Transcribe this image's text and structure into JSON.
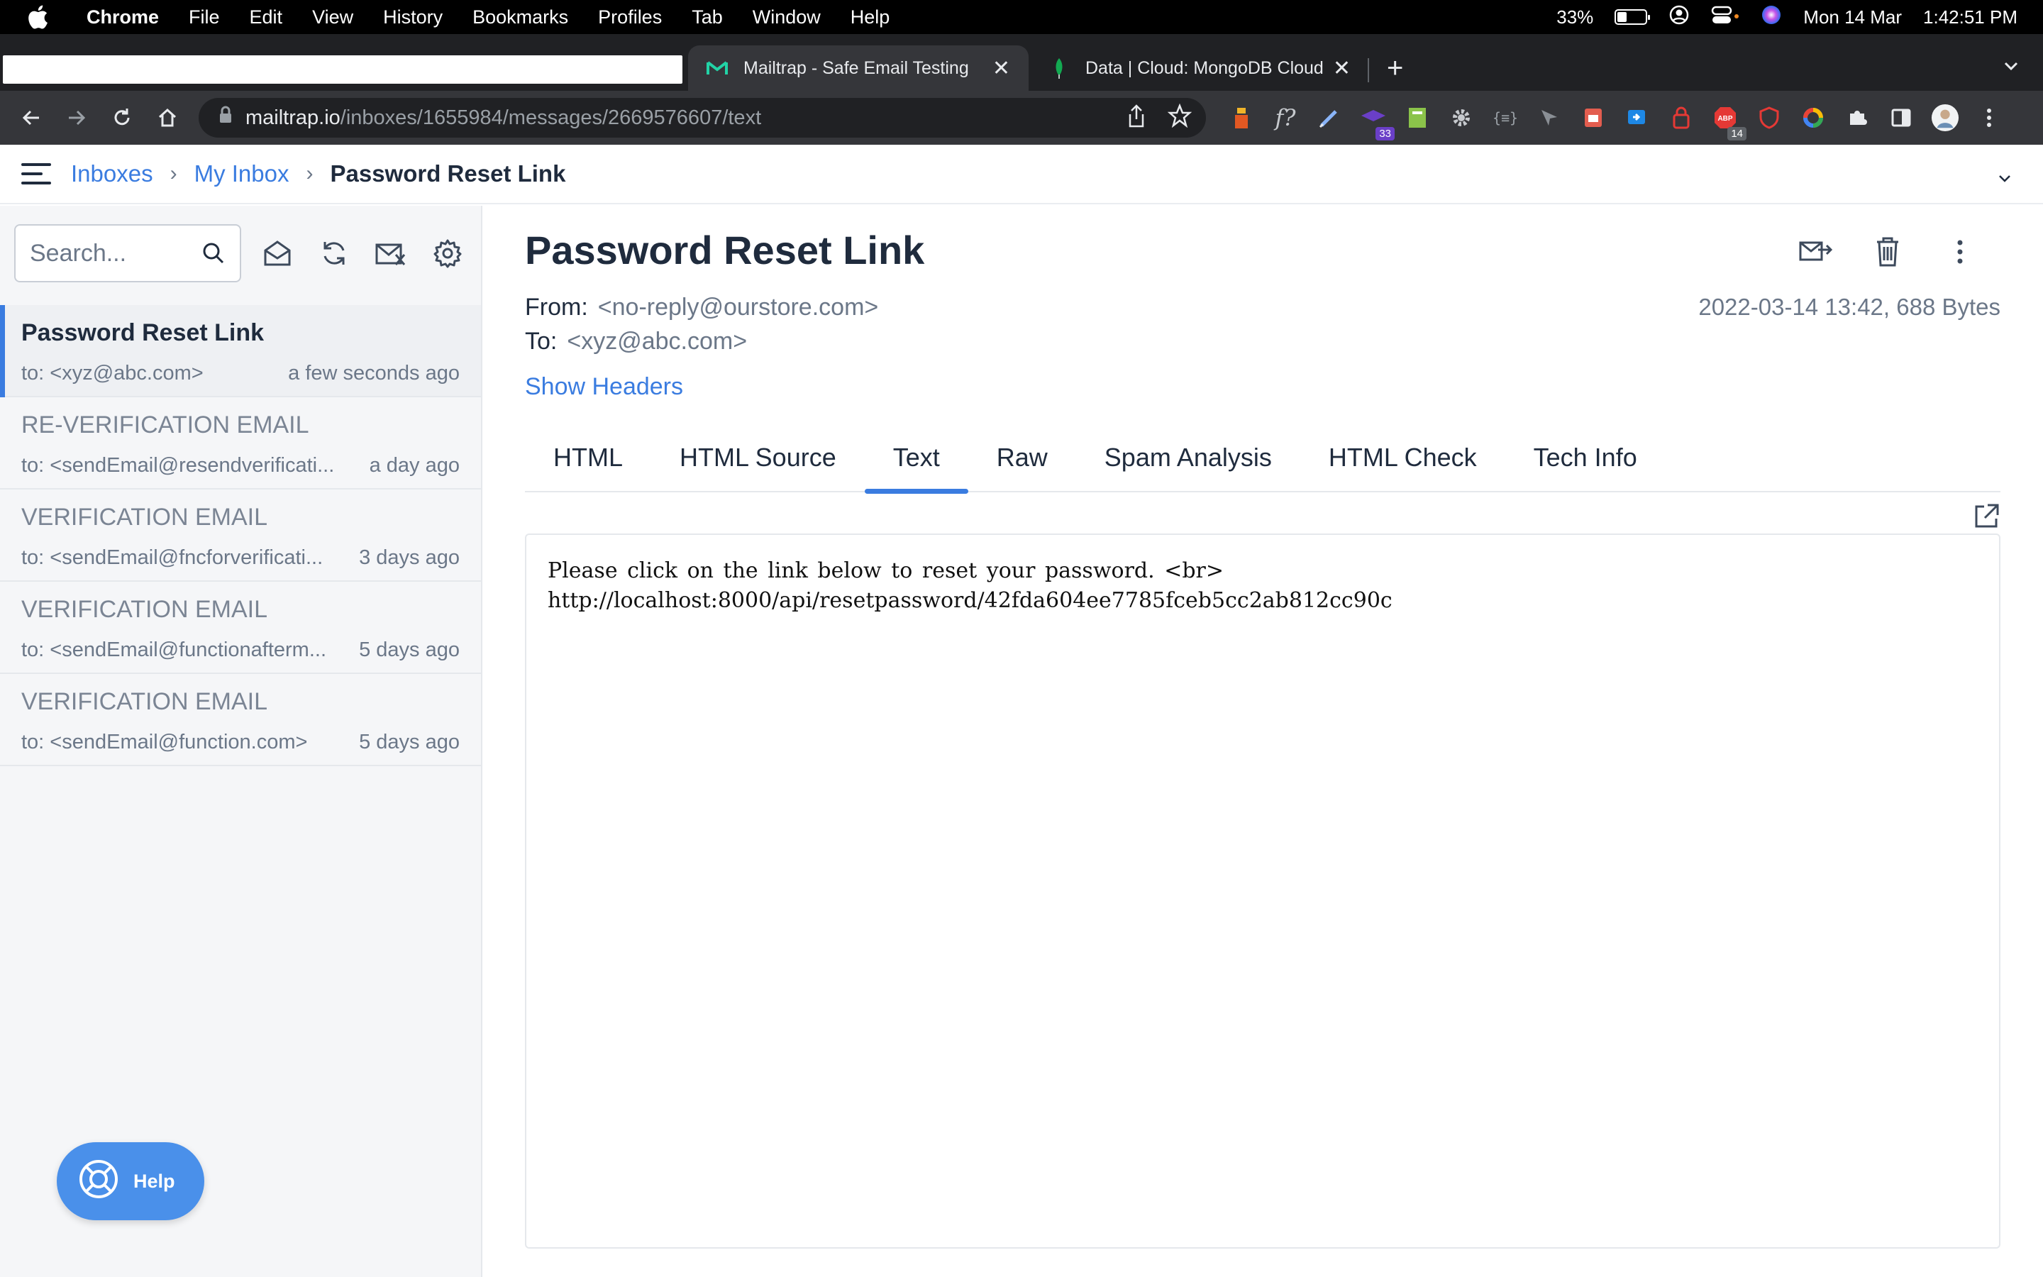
{
  "menubar": {
    "app": "Chrome",
    "items": [
      "File",
      "Edit",
      "View",
      "History",
      "Bookmarks",
      "Profiles",
      "Tab",
      "Window",
      "Help"
    ],
    "battery_pct": "33%",
    "battery_level": 0.33,
    "datetime_day": "Mon 14 Mar",
    "datetime_time": "1:42:51 PM"
  },
  "tabs": [
    {
      "title": "Mailtrap - Safe Email Testing",
      "active": true,
      "icon": "mailtrap-icon"
    },
    {
      "title": "Data | Cloud: MongoDB Cloud",
      "active": false,
      "icon": "mongodb-leaf-icon"
    }
  ],
  "address": {
    "host": "mailtrap.io",
    "path": "/inboxes/1655984/messages/2669576607/text"
  },
  "extensions": {
    "badge_purple": "33",
    "badge_abp": "14",
    "abp_label": "ABP"
  },
  "breadcrumb": {
    "inboxes": "Inboxes",
    "my_inbox": "My Inbox",
    "current": "Password Reset Link"
  },
  "sidebar": {
    "search_placeholder": "Search...",
    "messages": [
      {
        "subject": "Password Reset Link",
        "to": "to: <xyz@abc.com>",
        "when": "a few seconds ago",
        "selected": true
      },
      {
        "subject": "RE-VERIFICATION EMAIL",
        "to": "to: <sendEmail@resendverificati...",
        "when": "a day ago",
        "selected": false
      },
      {
        "subject": "VERIFICATION EMAIL",
        "to": "to: <sendEmail@fncforverificati...",
        "when": "3 days ago",
        "selected": false
      },
      {
        "subject": "VERIFICATION EMAIL",
        "to": "to: <sendEmail@functionafterm...",
        "when": "5 days ago",
        "selected": false
      },
      {
        "subject": "VERIFICATION EMAIL",
        "to": "to: <sendEmail@function.com>",
        "when": "5 days ago",
        "selected": false
      }
    ],
    "help_label": "Help"
  },
  "message": {
    "title": "Password Reset Link",
    "from_label": "From:",
    "from": "<no-reply@ourstore.com>",
    "to_label": "To:",
    "to": "<xyz@abc.com>",
    "meta": "2022-03-14 13:42, 688 Bytes",
    "show_headers": "Show Headers",
    "tabs": [
      "HTML",
      "HTML Source",
      "Text",
      "Raw",
      "Spam Analysis",
      "HTML Check",
      "Tech Info"
    ],
    "active_tab": "Text",
    "body_line1": "Please click on the link below to reset your password. <br>",
    "body_line2": "http://localhost:8000/api/resetpassword/42fda604ee7785fceb5cc2ab812cc90c"
  },
  "colors": {
    "accent": "#3a7ce0",
    "help": "#4a90ea",
    "menubar": "#000000",
    "chrome_dark": "#202124"
  }
}
